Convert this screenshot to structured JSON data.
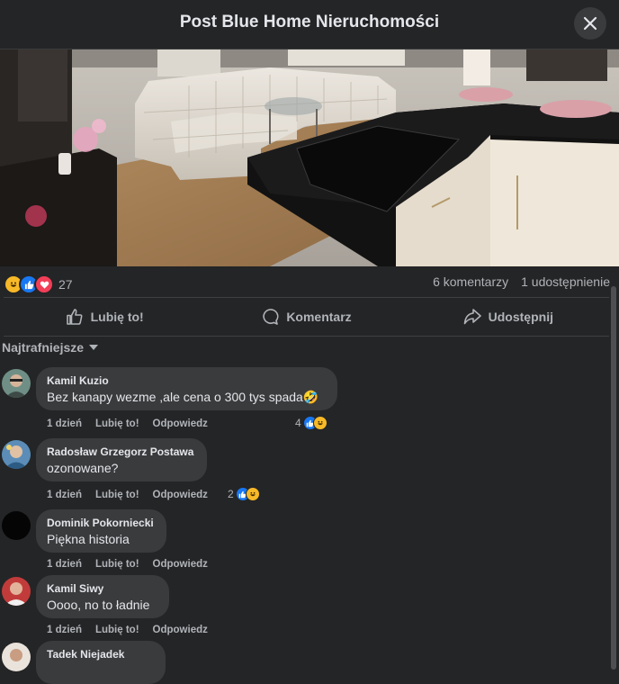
{
  "header": {
    "title": "Post Blue Home Nieruchomości",
    "close_icon": "close-icon"
  },
  "post": {
    "photo_description_icon": "photo",
    "reaction_count": "27",
    "comments_count": "6 komentarzy",
    "shares_count": "1 udostępnienie",
    "reaction_types": [
      "haha",
      "like",
      "love"
    ]
  },
  "actions": {
    "like": "Lubię to!",
    "comment": "Komentarz",
    "share": "Udostępnij"
  },
  "sort": {
    "label": "Najtrafniejsze"
  },
  "comments": [
    {
      "name": "Kamil Kuzio",
      "text": "Bez kanapy wezme ,ale cena o 300 tys spada🤣",
      "time": "1 dzień",
      "like": "Lubię to!",
      "reply": "Odpowiedz",
      "reactions": "4"
    },
    {
      "name": "Radosław Grzegorz Postawa",
      "text": "ozonowane?",
      "time": "1 dzień",
      "like": "Lubię to!",
      "reply": "Odpowiedz",
      "reactions": "2"
    },
    {
      "name": "Dominik Pokorniecki",
      "text": "Piękna historia",
      "time": "1 dzień",
      "like": "Lubię to!",
      "reply": "Odpowiedz"
    },
    {
      "name": "Kamil Siwy",
      "text": "Oooo, no to ładnie",
      "time": "1 dzień",
      "like": "Lubię to!",
      "reply": "Odpowiedz"
    },
    {
      "name": "Tadek Niejadek"
    }
  ],
  "colors": {
    "like_blue": "#1877f2",
    "love_red": "#f33e58",
    "haha_yellow": "#f7b928",
    "background": "#242526",
    "bubble": "#3a3b3c"
  }
}
